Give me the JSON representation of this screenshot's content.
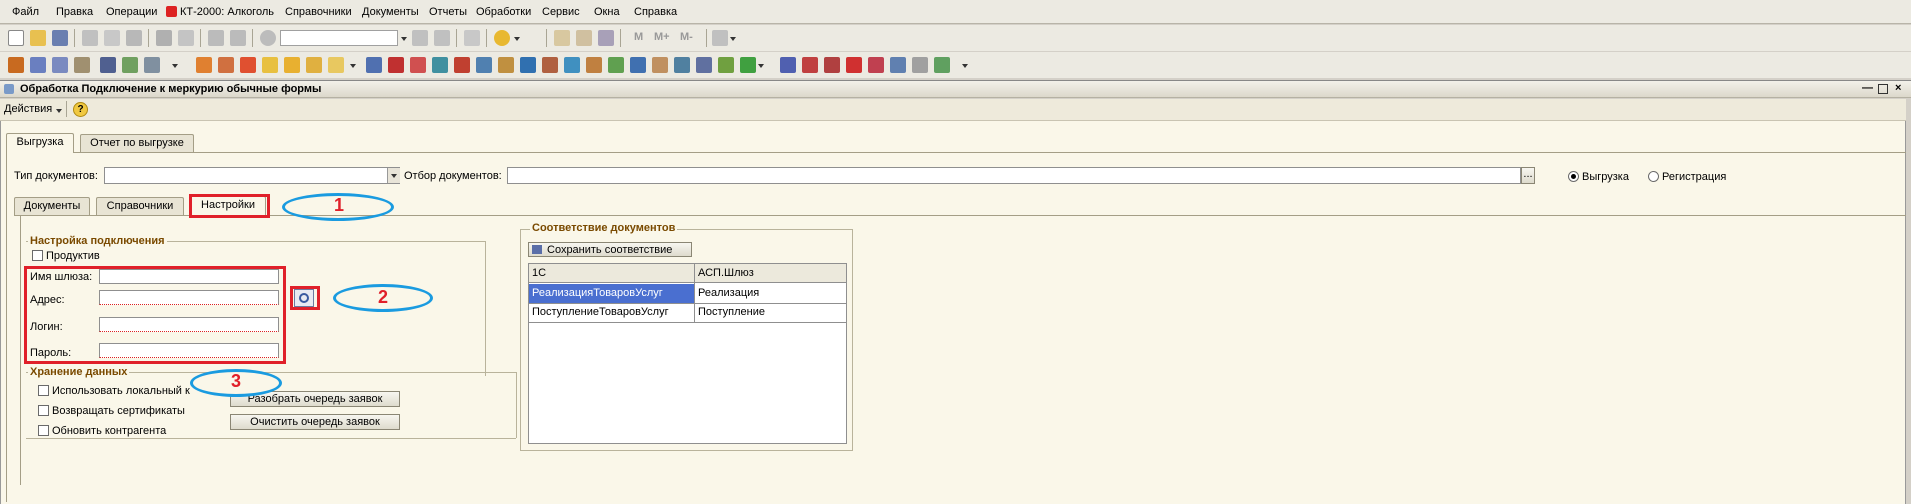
{
  "menu": {
    "file": "Файл",
    "edit": "Правка",
    "operations": "Операции",
    "kt": "КТ-2000: Алкоголь",
    "directories": "Справочники",
    "documents": "Документы",
    "reports": "Отчеты",
    "processing": "Обработки",
    "service": "Сервис",
    "windows": "Окна",
    "help": "Справка"
  },
  "toolbar": {
    "m": "M",
    "m_plus": "M+",
    "m_minus": "M-"
  },
  "window": {
    "title": "Обработка  Подключение к меркурию обычные формы",
    "actions_label": "Действия"
  },
  "main_tabs": [
    {
      "label": "Выгрузка"
    },
    {
      "label": "Отчет по выгрузке"
    }
  ],
  "filters": {
    "doc_type_label": "Тип документов:",
    "doc_type_value": "",
    "doc_filter_label": "Отбор документов:",
    "doc_filter_value": "",
    "browse_label": "...",
    "radio_upload": "Выгрузка",
    "radio_registration": "Регистрация"
  },
  "sub_tabs": [
    {
      "label": "Документы"
    },
    {
      "label": "Справочники"
    },
    {
      "label": "Настройки"
    }
  ],
  "connection": {
    "title": "Настройка подключения",
    "productive_label": "Продуктив",
    "gateway_label": "Имя шлюза:",
    "gateway_value": "",
    "address_label": "Адрес:",
    "address_value": "",
    "login_label": "Логин:",
    "login_value": "",
    "password_label": "Пароль:",
    "password_value": ""
  },
  "storage": {
    "title": "Хранение данных",
    "use_local_label": "Использовать локальный к",
    "return_certs_label": "Возвращать сертификаты",
    "update_contractor_label": "Обновить контрагента",
    "parse_queue_button": "Разобрать очередь заявок",
    "clear_queue_button": "Очистить очередь заявок"
  },
  "mapping": {
    "title": "Соответствие документов",
    "save_button": "Сохранить соответствие",
    "columns": [
      "1С",
      "АСП.Шлюз"
    ],
    "rows": [
      [
        "РеализацияТоваровУслуг",
        "Реализация"
      ],
      [
        "ПоступлениеТоваровУслуг",
        "Поступление"
      ]
    ]
  },
  "annotations": {
    "n1": "1",
    "n2": "2",
    "n3": "3"
  },
  "colors": {
    "annotation_red": "#e0202a",
    "annotation_blue": "#1a9be0",
    "selection_blue": "#4a6fd0",
    "group_title": "#7a4a00"
  }
}
